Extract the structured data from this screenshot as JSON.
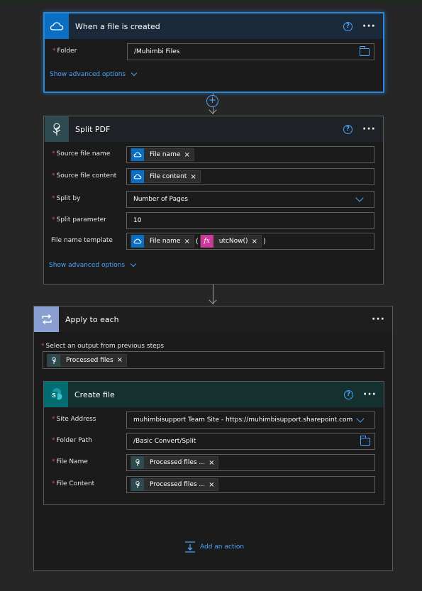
{
  "trigger": {
    "title": "When a file is created",
    "folder_label": "Folder",
    "folder_value": "/Muhimbi Files",
    "advanced_label": "Show advanced options"
  },
  "split_pdf": {
    "title": "Split PDF",
    "source_name_label": "Source file name",
    "source_name_token": "File name",
    "source_content_label": "Source file content",
    "source_content_token": "File content",
    "split_by_label": "Split by",
    "split_by_value": "Number of Pages",
    "split_param_label": "Split parameter",
    "split_param_value": "10",
    "template_label": "File name template",
    "template_token": "File name",
    "template_func": "utcNow()",
    "template_func_icon": "fx",
    "paren_open": "(",
    "paren_close": ")",
    "advanced_label": "Show advanced options"
  },
  "apply_each": {
    "title": "Apply to each",
    "select_label": "Select an output from previous steps",
    "select_token": "Processed files"
  },
  "create_file": {
    "title": "Create file",
    "site_label": "Site Address",
    "site_value": "muhimbisupport Team Site - https://muhimbisupport.sharepoint.com",
    "folder_label": "Folder Path",
    "folder_value": "/Basic Convert/Split",
    "name_label": "File Name",
    "name_token": "Processed files ...",
    "content_label": "File Content",
    "content_token": "Processed files ..."
  },
  "add_action_label": "Add an action",
  "symbols": {
    "required": "*",
    "remove": "×",
    "more": "···",
    "help": "?",
    "plus": "+"
  },
  "colors": {
    "onedrive": "#0a6fc2",
    "muhimbi": "#2d4a50",
    "loop": "#8a9fd1",
    "sharepoint": "#036c70",
    "fx": "#ca3a98",
    "link": "#4aa3ff",
    "required": "#e04f4f"
  }
}
